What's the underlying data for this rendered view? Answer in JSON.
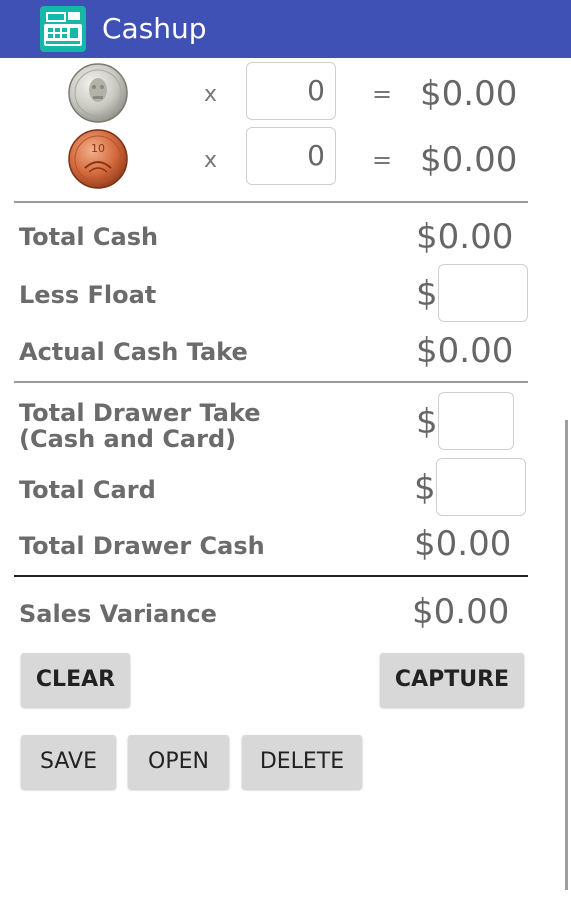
{
  "app_bar": {
    "title": "Cashup",
    "icon": "cash-register-icon",
    "color": "#3f51b5"
  },
  "coins": [
    {
      "name": "nz-20-cent-coin",
      "times": "x",
      "count": "0",
      "equals": "=",
      "subtotal": "$0.00"
    },
    {
      "name": "nz-10-cent-coin",
      "times": "x",
      "count": "0",
      "equals": "=",
      "subtotal": "$0.00"
    }
  ],
  "summary": {
    "total_cash_label": "Total Cash",
    "total_cash_value": "$0.00",
    "less_float_label": "Less Float",
    "less_float_currency": "$",
    "less_float_value": "",
    "actual_cash_take_label": "Actual Cash Take",
    "actual_cash_take_value": "$0.00",
    "total_drawer_take_label_1": "Total Drawer Take",
    "total_drawer_take_label_2": "(Cash and Card)",
    "total_drawer_take_currency": "$",
    "total_drawer_take_value": "",
    "total_card_label": "Total Card",
    "total_card_currency": "$",
    "total_card_value": "",
    "total_drawer_cash_label": "Total Drawer Cash",
    "total_drawer_cash_value": "$0.00",
    "sales_variance_label": "Sales Variance",
    "sales_variance_value": "$0.00"
  },
  "buttons": {
    "clear": "CLEAR",
    "capture": "CAPTURE",
    "save": "SAVE",
    "open": "OPEN",
    "delete": "DELETE"
  }
}
